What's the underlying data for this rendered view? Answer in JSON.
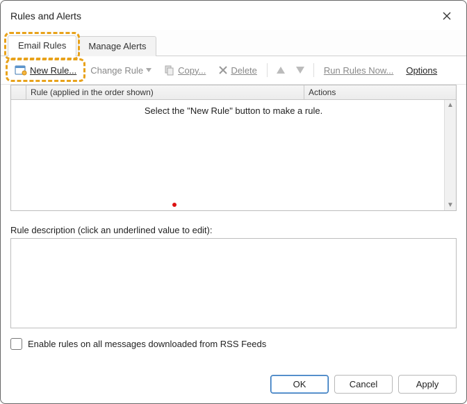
{
  "window": {
    "title": "Rules and Alerts"
  },
  "tabs": {
    "email_rules": "Email Rules",
    "manage_alerts": "Manage Alerts"
  },
  "toolbar": {
    "new_rule": "New Rule...",
    "change_rule": "Change Rule",
    "copy": "Copy...",
    "delete": "Delete",
    "run_now": "Run Rules Now...",
    "options": "Options"
  },
  "grid": {
    "col_rule": "Rule (applied in the order shown)",
    "col_actions": "Actions",
    "empty_hint": "Select the \"New Rule\" button to make a rule."
  },
  "description": {
    "label": "Rule description (click an underlined value to edit):"
  },
  "rss": {
    "label": "Enable rules on all messages downloaded from RSS Feeds"
  },
  "buttons": {
    "ok": "OK",
    "cancel": "Cancel",
    "apply": "Apply"
  }
}
